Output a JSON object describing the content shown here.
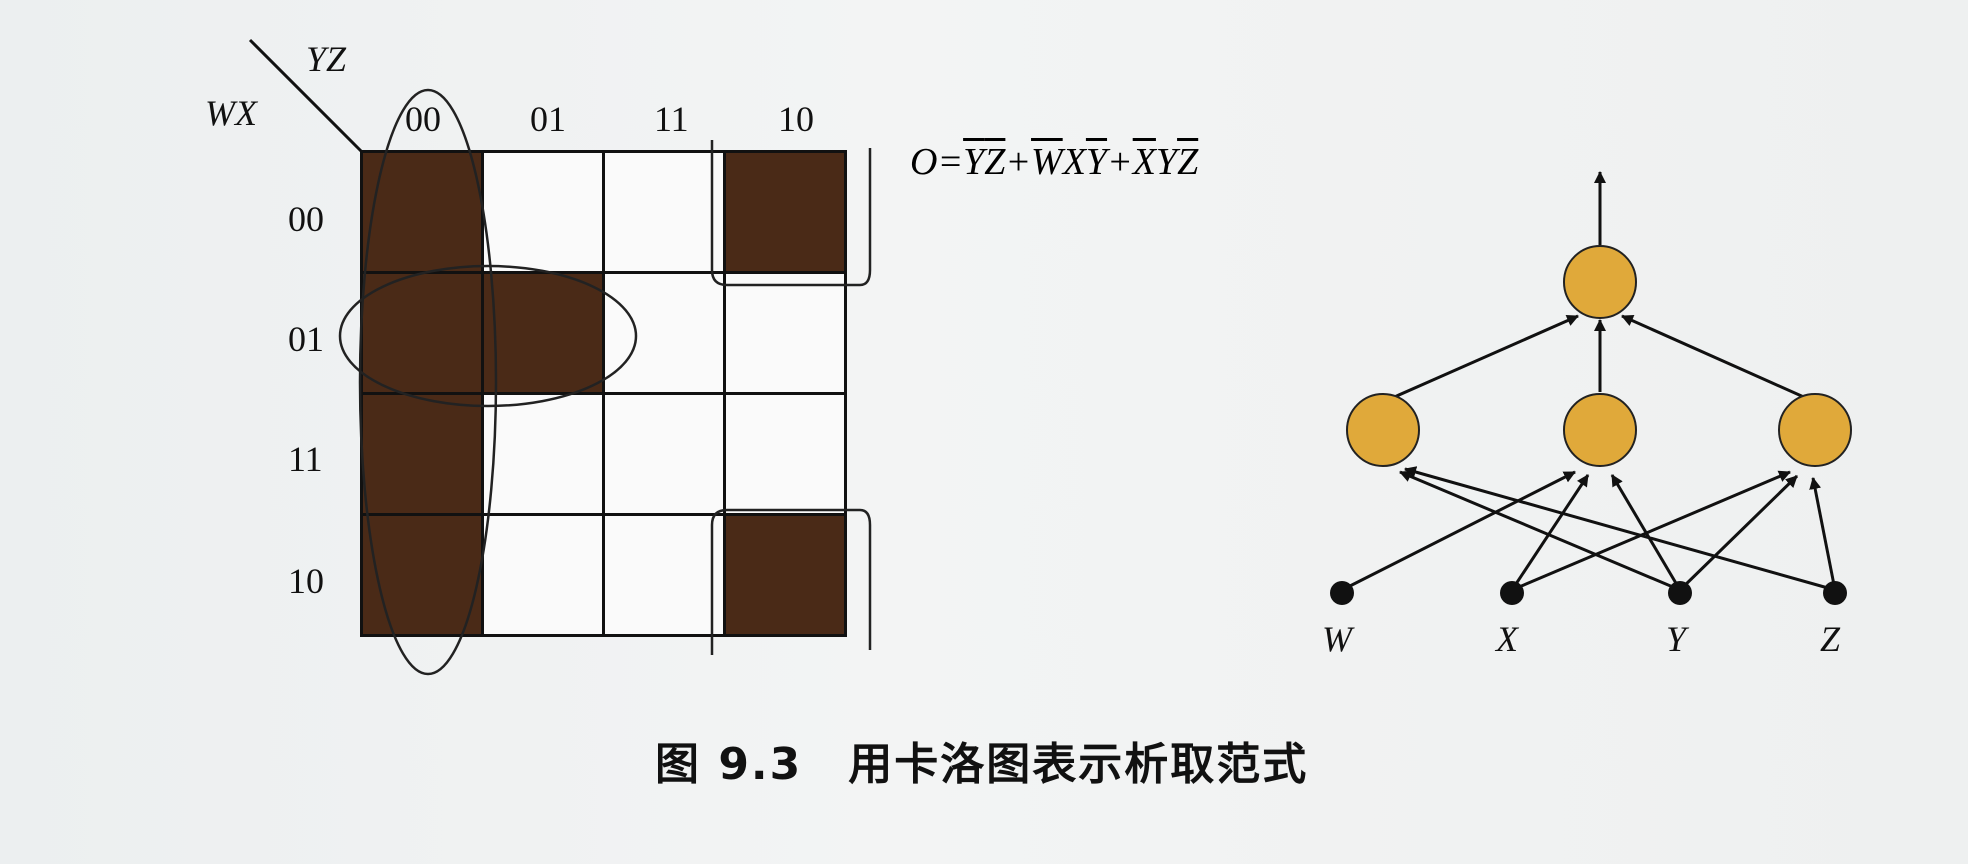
{
  "kmap": {
    "row_var": "WX",
    "col_var": "YZ",
    "col_labels": [
      "00",
      "01",
      "11",
      "10"
    ],
    "row_labels": [
      "00",
      "01",
      "11",
      "10"
    ],
    "cells": [
      [
        1,
        0,
        0,
        1
      ],
      [
        1,
        1,
        0,
        0
      ],
      [
        1,
        0,
        0,
        0
      ],
      [
        1,
        0,
        0,
        1
      ]
    ],
    "colors": {
      "filled": "#4a2a17",
      "empty": "#fafafa",
      "grid": "#111111"
    }
  },
  "formula": {
    "lhs": "O=",
    "terms": [
      [
        {
          "t": "Y",
          "bar": true
        },
        {
          "t": "Z",
          "bar": true
        }
      ],
      [
        {
          "t": "W",
          "bar": true
        },
        {
          "t": "X",
          "bar": false
        },
        {
          "t": "Y",
          "bar": true
        }
      ],
      [
        {
          "t": "X",
          "bar": true
        },
        {
          "t": "Y",
          "bar": false
        },
        {
          "t": "Z",
          "bar": true
        }
      ]
    ],
    "joiner": "+"
  },
  "network": {
    "inputs": [
      "W",
      "X",
      "Y",
      "Z"
    ],
    "node_color": "#e0a93a"
  },
  "caption": "图 9.3　用卡洛图表示析取范式"
}
